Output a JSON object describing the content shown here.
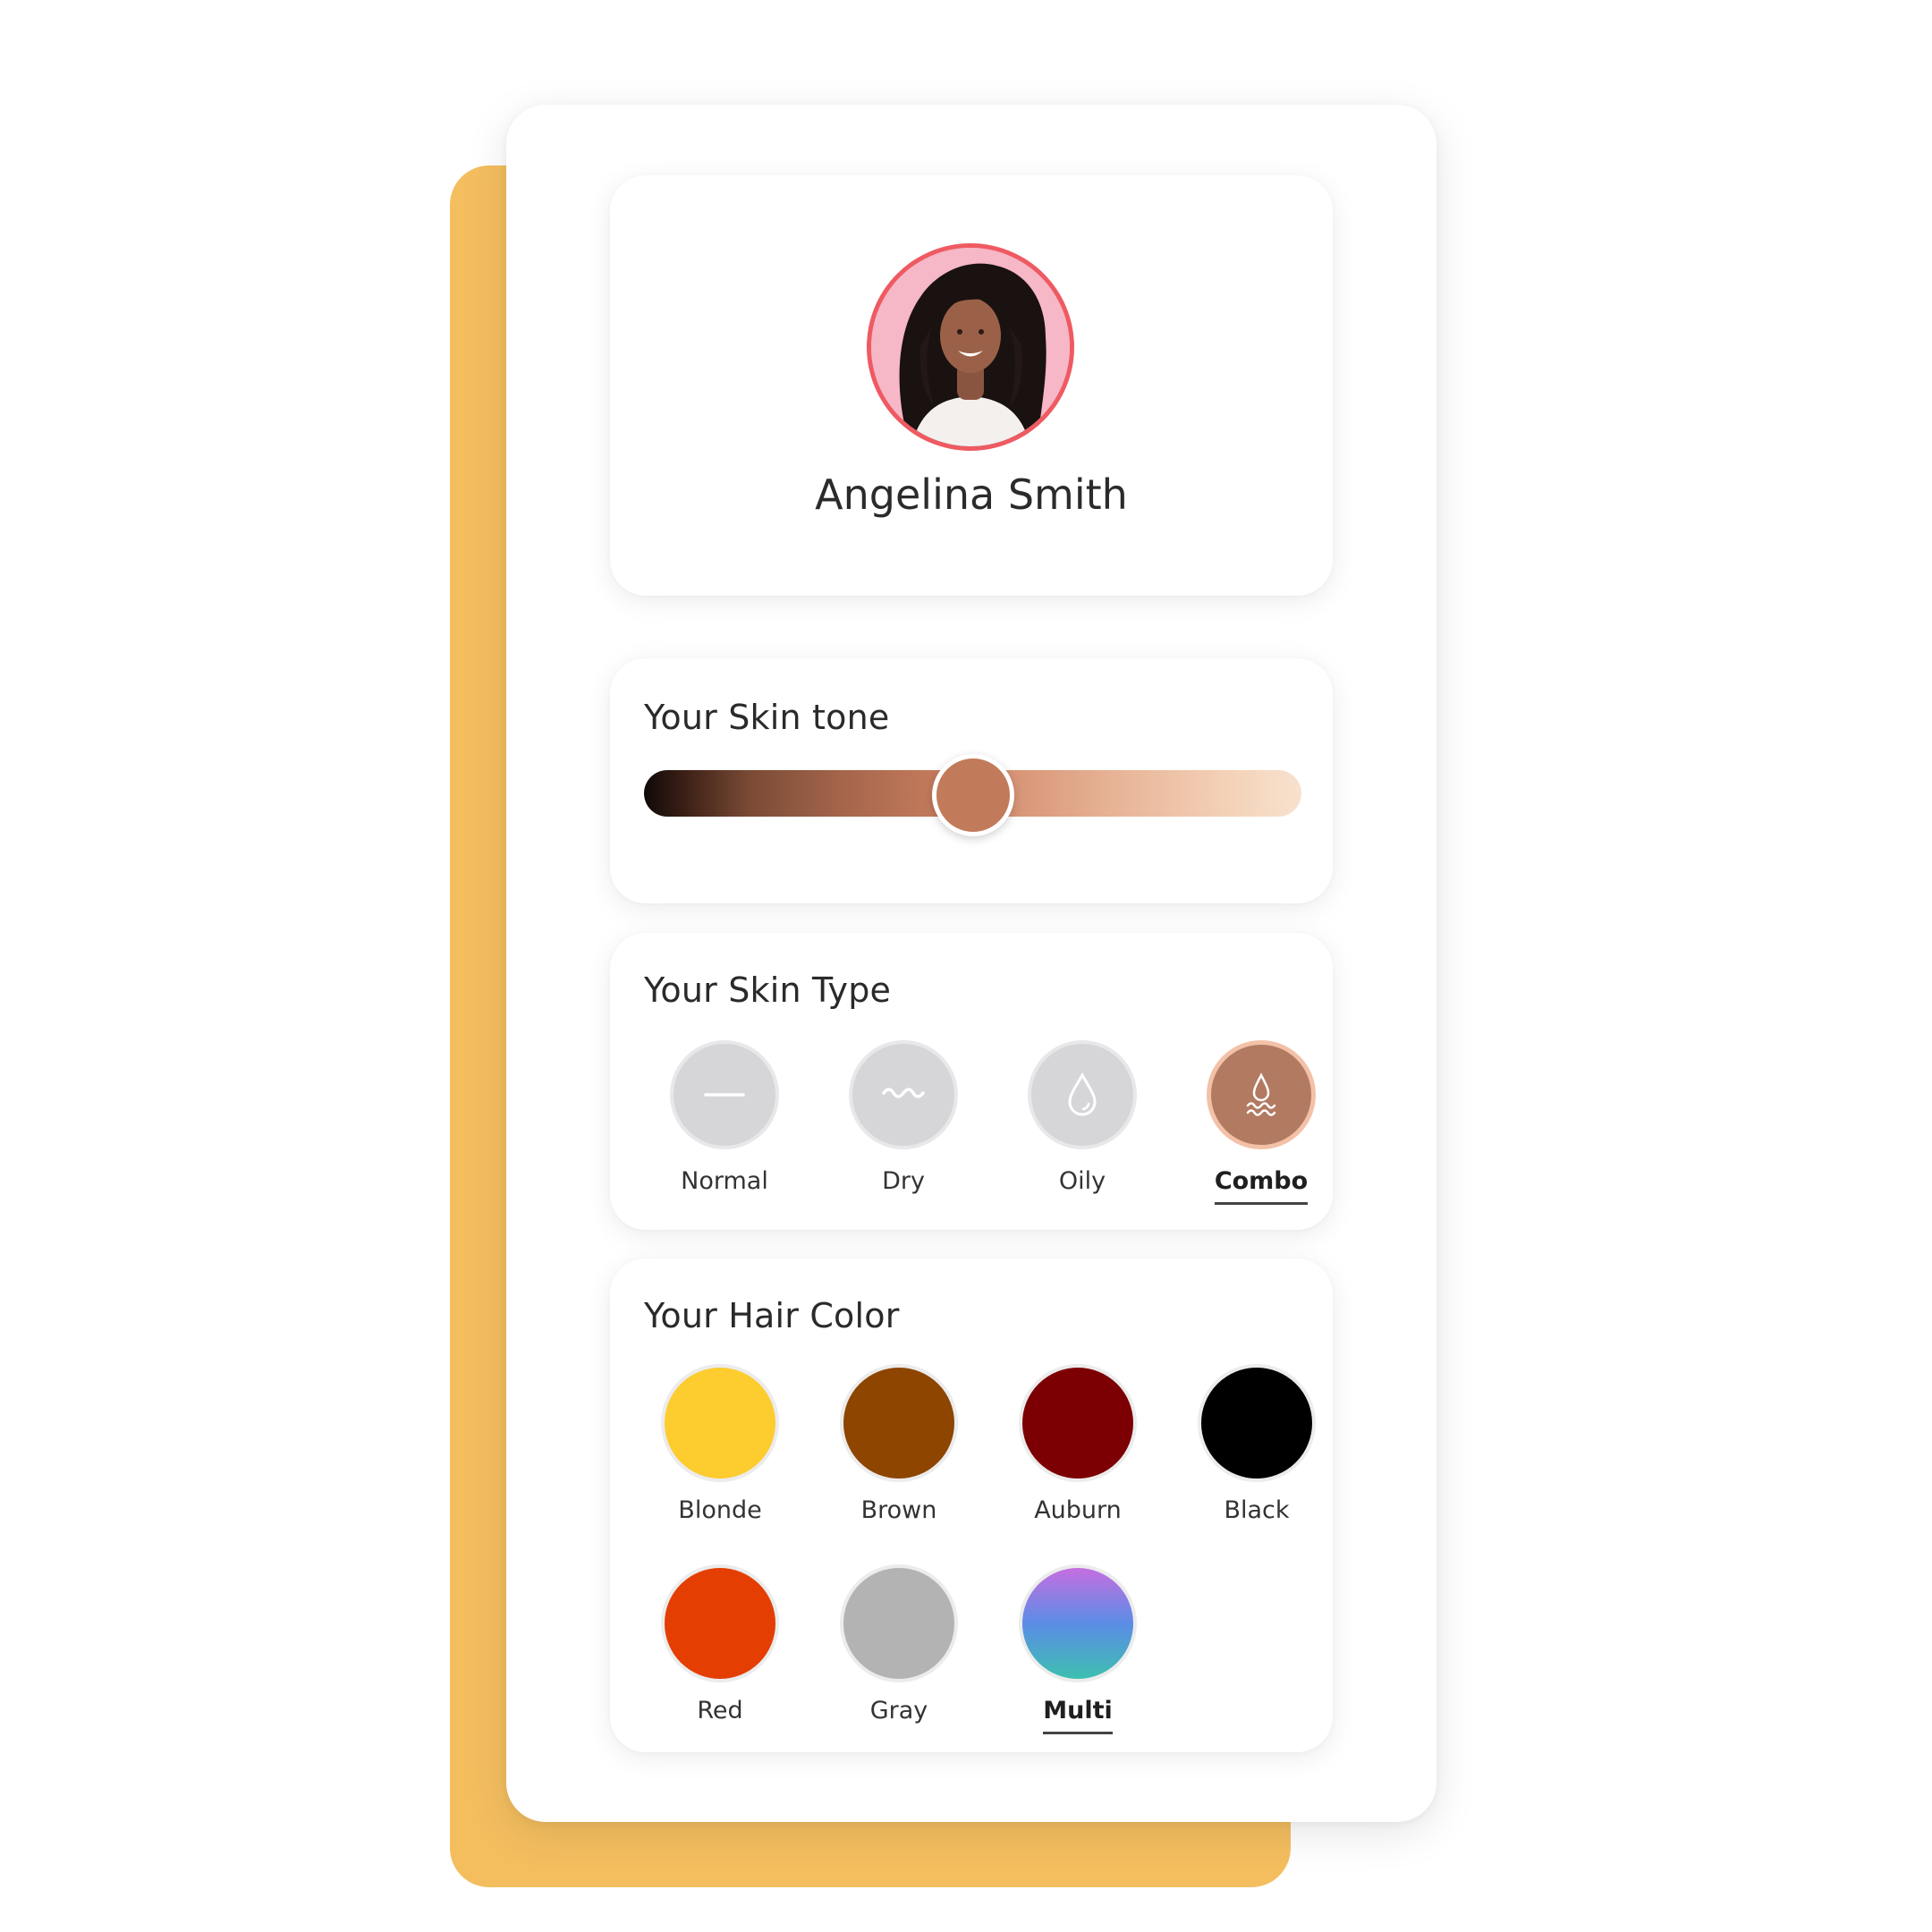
{
  "profile": {
    "name": "Angelina Smith",
    "avatar_ring_color": "#ef5a62"
  },
  "skin_tone": {
    "title": "Your Skin tone",
    "value_fraction": 0.5,
    "thumb_color": "#c27b5a"
  },
  "skin_type": {
    "title": "Your Skin Type",
    "options": [
      {
        "label": "Normal",
        "icon": "dash-icon",
        "selected": false
      },
      {
        "label": "Dry",
        "icon": "wave-icon",
        "selected": false
      },
      {
        "label": "Oily",
        "icon": "droplet-icon",
        "selected": false
      },
      {
        "label": "Combo",
        "icon": "droplet-wave-icon",
        "selected": true
      }
    ],
    "selected_color": "#b27a61"
  },
  "hair_color": {
    "title": "Your Hair Color",
    "options": [
      {
        "label": "Blonde",
        "color": "#fdcc2e",
        "selected": false
      },
      {
        "label": "Brown",
        "color": "#8d4500",
        "selected": false
      },
      {
        "label": "Auburn",
        "color": "#7c0003",
        "selected": false
      },
      {
        "label": "Black",
        "color": "#000000",
        "selected": false
      },
      {
        "label": "Red",
        "color": "#e43e02",
        "selected": false
      },
      {
        "label": "Gray",
        "color": "#b3b3b3",
        "selected": false
      },
      {
        "label": "Multi",
        "color": "gradient",
        "gradient_colors": [
          "#c56ee0",
          "#5b8de6",
          "#3dbfb0"
        ],
        "selected": true
      }
    ]
  },
  "colors": {
    "background_card": "#f4be5f"
  }
}
